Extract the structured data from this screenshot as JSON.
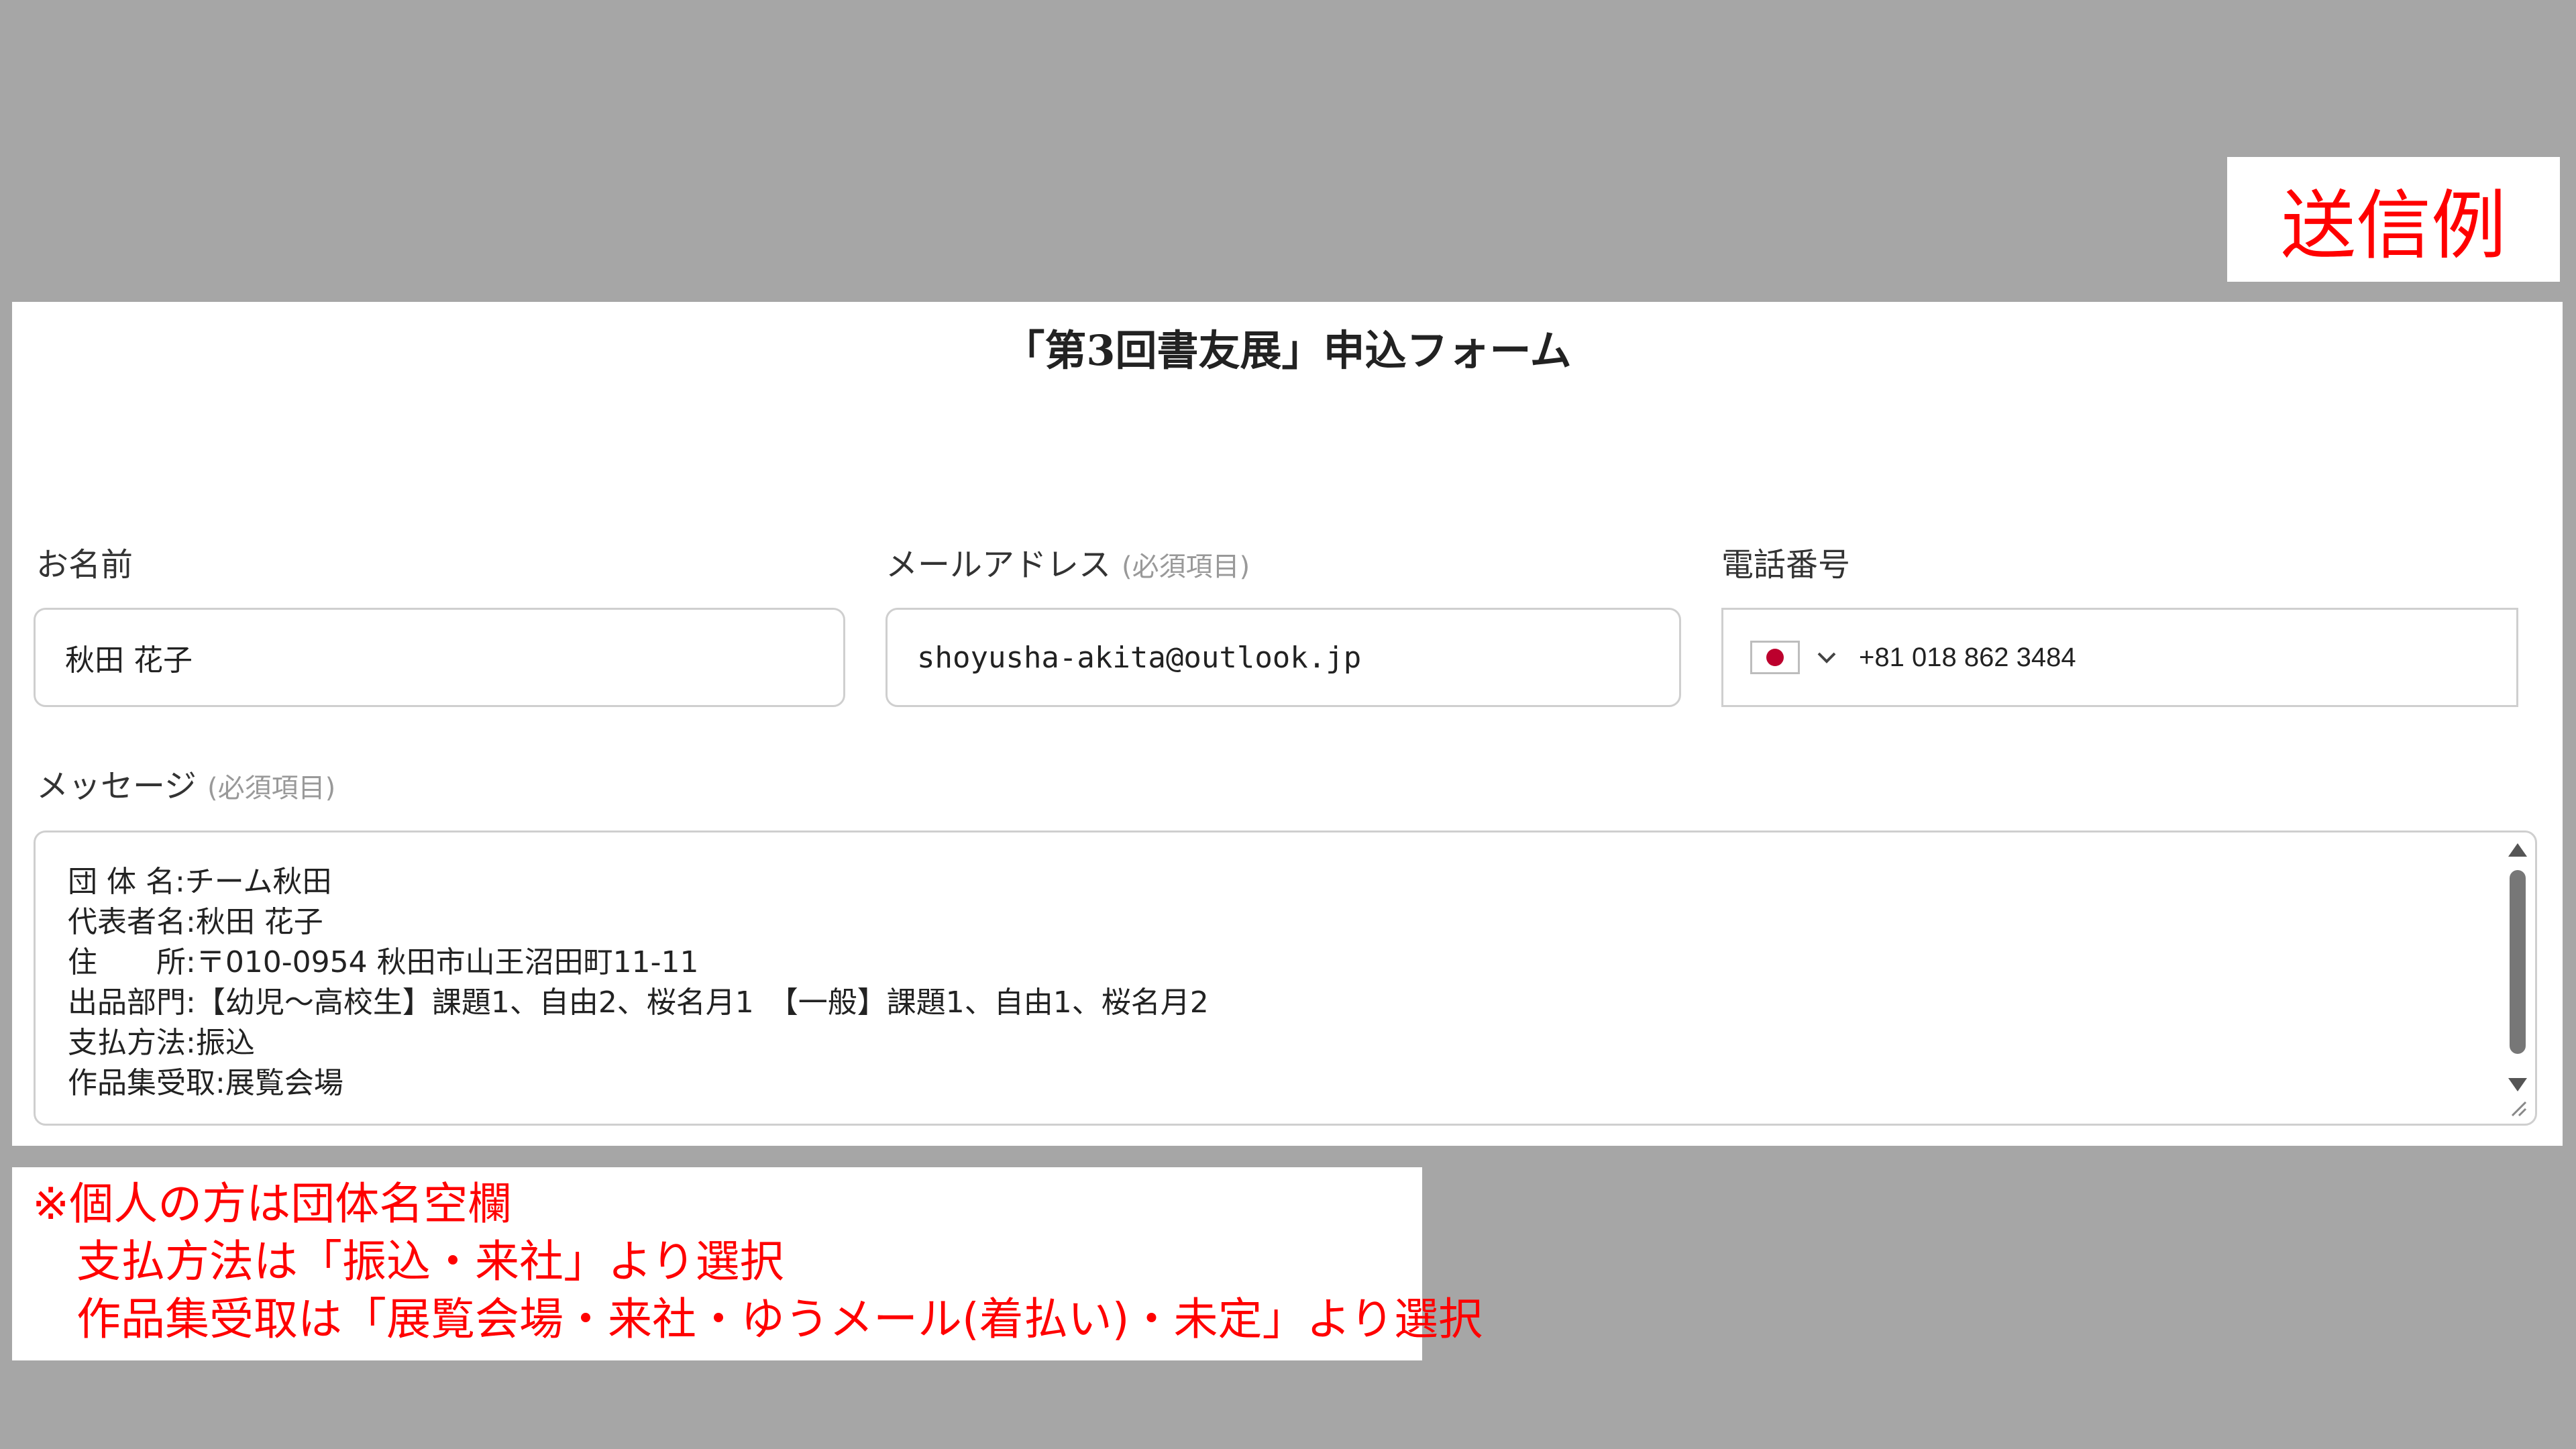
{
  "badge": "送信例",
  "form": {
    "title": "「第3回書友展」申込フォーム",
    "name_label": "お名前",
    "name_value": "秋田 花子",
    "email_label": "メールアドレス",
    "email_required": "(必須項目)",
    "email_value": "shoyusha-akita@outlook.jp",
    "phone_label": "電話番号",
    "phone_country": "jp-flag-icon",
    "phone_value": "+81 018 862 3484",
    "message_label": "メッセージ",
    "message_required": "(必須項目)",
    "message_lines": [
      "団 体 名:チーム秋田",
      "代表者名:秋田 花子",
      "住　　所:〒010-0954 秋田市山王沼田町11-11",
      "出品部門:【幼児～高校生】課題1、自由2、桜名月1　【一般】課題1、自由1、桜名月2",
      "支払方法:振込",
      "作品集受取:展覧会場"
    ]
  },
  "note": {
    "lines": [
      "※個人の方は団体名空欄",
      "　支払方法は「振込・来社」より選択",
      "　作品集受取は「展覧会場・来社・ゆうメール(着払い)・未定」より選択"
    ]
  },
  "colors": {
    "background": "#a6a6a6",
    "accent_red": "#ff0000",
    "border": "#cfcfcf"
  }
}
